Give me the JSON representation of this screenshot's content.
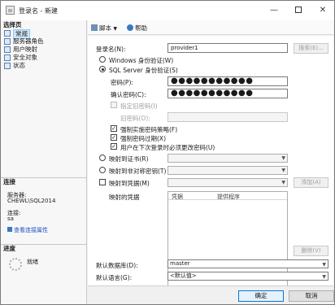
{
  "window": {
    "title": "登录名 - 新建"
  },
  "left": {
    "select_page_header": "选择页",
    "pages": [
      "常规",
      "服务器角色",
      "用户映射",
      "安全对象",
      "状态"
    ],
    "connection_header": "连接",
    "server_label": "服务器:",
    "server_value": "CHEWL\\SQL2014",
    "connection_label": "连接:",
    "connection_value": "sa",
    "view_props_link": "查看连接属性",
    "progress_header": "进度",
    "progress_status": "就绪"
  },
  "toolbar": {
    "script_label": "脚本",
    "help_label": "帮助"
  },
  "form": {
    "login_name_label": "登录名(N):",
    "login_name_value": "provider1",
    "search_button": "搜索(E)...",
    "windows_auth_label": "Windows 身份验证(W)",
    "sql_auth_label": "SQL Server 身份验证(S)",
    "password_label": "密码(P):",
    "password_value": "●●●●●●●●●●●",
    "confirm_password_label": "确认密码(C):",
    "confirm_password_value": "●●●●●●●●●●●",
    "specify_old_password_label": "指定旧密码(I)",
    "old_password_label": "旧密码(O):",
    "enforce_policy_label": "强制实施密码策略(F)",
    "enforce_expiration_label": "强制密码过期(X)",
    "must_change_label": "用户在下次登录时必须更改密码(U)",
    "map_cert_label": "映射到证书(R)",
    "map_asym_key_label": "映射到非对称密钥(T)",
    "map_credential_label": "映射到凭据(M)",
    "add_button": "添加(A)",
    "mapped_credentials_label": "映射的凭据",
    "cred_col_credential": "凭据",
    "cred_col_provider": "提供程序",
    "remove_button": "删除(V)",
    "default_db_label": "默认数据库(D):",
    "default_db_value": "master",
    "default_lang_label": "默认语言(G):",
    "default_lang_value": "<默认值>"
  },
  "buttons": {
    "ok": "确定",
    "cancel": "取消"
  }
}
